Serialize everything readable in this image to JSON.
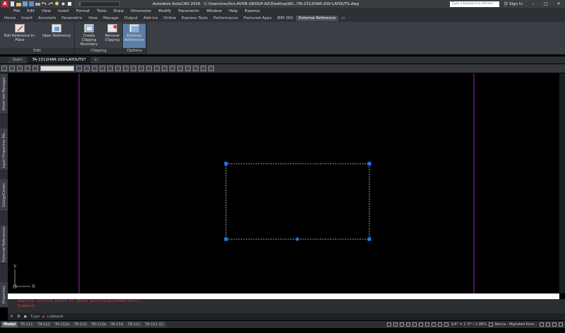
{
  "titlebar": {
    "app_name": "Autodesk AutoCAD 2016",
    "file_path": "C:\\Users\\rsullins.AVDB-GROUP-AZ\\Desktop\\AV...\\TA-1512HAR-100-LAYOUTS.dwg",
    "search_placeholder": "Type a keyword or phrase",
    "signin": "Sign In",
    "workspace_value": "0"
  },
  "menubar": [
    "File",
    "Edit",
    "View",
    "Insert",
    "Format",
    "Tools",
    "Draw",
    "Dimension",
    "Modify",
    "Parametric",
    "Window",
    "Help",
    "Express"
  ],
  "ribbon_tabs": {
    "items": [
      "Home",
      "Insert",
      "Annotate",
      "Parametric",
      "View",
      "Manage",
      "Output",
      "Add-ins",
      "Online",
      "Express Tools",
      "Performance",
      "Featured Apps",
      "BIM 360",
      "External Reference"
    ],
    "active": "External Reference"
  },
  "ribbon": {
    "edit_group": {
      "label": "Edit",
      "edit_in_place": "Edit Reference In-Place",
      "open_reference": "Open Reference"
    },
    "clipping_group": {
      "label": "Clipping",
      "create_boundary": "Create Clipping Boundary",
      "remove_clipping": "Remove Clipping"
    },
    "options_group": {
      "label": "Options",
      "external_references": "External References"
    }
  },
  "doc_tabs": {
    "start": "Start",
    "active": "TA-1512HAR-100-LAYOUTS*",
    "plus": "+"
  },
  "side_palettes": [
    "Sheet Set Manager",
    "Layer Properties Ma...",
    "DesignCenter",
    "External References",
    "Properties"
  ],
  "ucs": {
    "x": "X",
    "y": "Y"
  },
  "command": {
    "history": [
      "Specify stretch point or [Base point/Copy/Undo/eXit]:",
      "Command:"
    ],
    "placeholder": "Type a command"
  },
  "layout_tabs": [
    "Model",
    "TA-111",
    "TA-112",
    "TA-112a",
    "TA-113",
    "TA-113a",
    "TA-114",
    "TA-121",
    "TA-121 (2)"
  ],
  "status": {
    "scale": "1/4\" = 1'-0\" / 2.08%",
    "user": "Becca - Migrated from..."
  },
  "colors": {
    "canvas": "#000000",
    "magenta_line": "#a020c0",
    "grip": "#1e78ff",
    "accent": "#5a7ea8"
  }
}
